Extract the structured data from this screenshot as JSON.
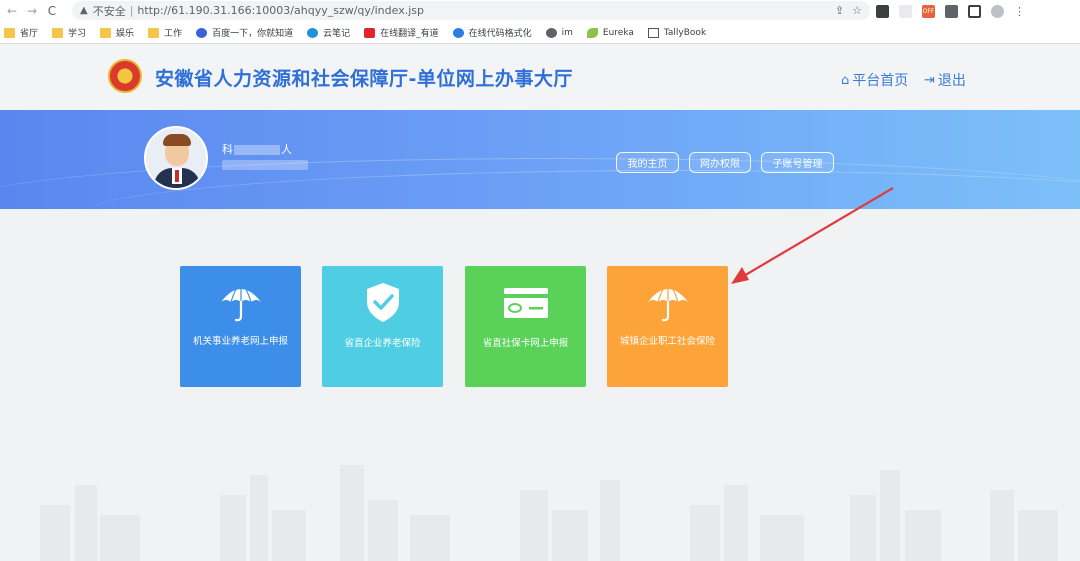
{
  "browser": {
    "security_text": "不安全",
    "url": "http://61.190.31.166:10003/ahqyy_szw/qy/index.jsp",
    "nav_back": "←",
    "nav_forward": "→",
    "nav_reload": "C",
    "ext_off_label": "OFF",
    "bookmarks": [
      {
        "label": "省厅",
        "icon": "folder-icon"
      },
      {
        "label": "学习",
        "icon": "folder-icon"
      },
      {
        "label": "娱乐",
        "icon": "folder-icon"
      },
      {
        "label": "工作",
        "icon": "folder-icon"
      },
      {
        "label": "百度一下，你就知道",
        "icon": "paw-icon"
      },
      {
        "label": "云笔记",
        "icon": "cloud-icon"
      },
      {
        "label": "在线翻译_有道",
        "icon": "youdao-icon"
      },
      {
        "label": "在线代码格式化",
        "icon": "edge-icon"
      },
      {
        "label": "im",
        "icon": "globe-icon"
      },
      {
        "label": "Eureka",
        "icon": "leaf-icon"
      },
      {
        "label": "TallyBook",
        "icon": "tally-icon"
      }
    ]
  },
  "header": {
    "title": "安徽省人力资源和社会保障厅-单位网上办事大厅",
    "home_link": "平台首页",
    "logout_link": "退出"
  },
  "banner": {
    "user_name_start": "科",
    "user_name_end": "人",
    "buttons": [
      "我的主页",
      "网办权限",
      "子账号管理"
    ]
  },
  "cards": [
    {
      "label": "机关事业养老网上申报",
      "color": "#3c8ee8",
      "icon": "umbrella-icon"
    },
    {
      "label": "省直企业养老保险",
      "color": "#4fcde3",
      "icon": "shield-check-icon"
    },
    {
      "label": "省直社保卡网上申报",
      "color": "#5ad25a",
      "icon": "card-icon"
    },
    {
      "label": "城镇企业职工社会保险",
      "color": "#fca339",
      "icon": "umbrella-icon"
    }
  ],
  "colors": {
    "title": "#2f6fd8",
    "arrow": "#e0393e"
  }
}
